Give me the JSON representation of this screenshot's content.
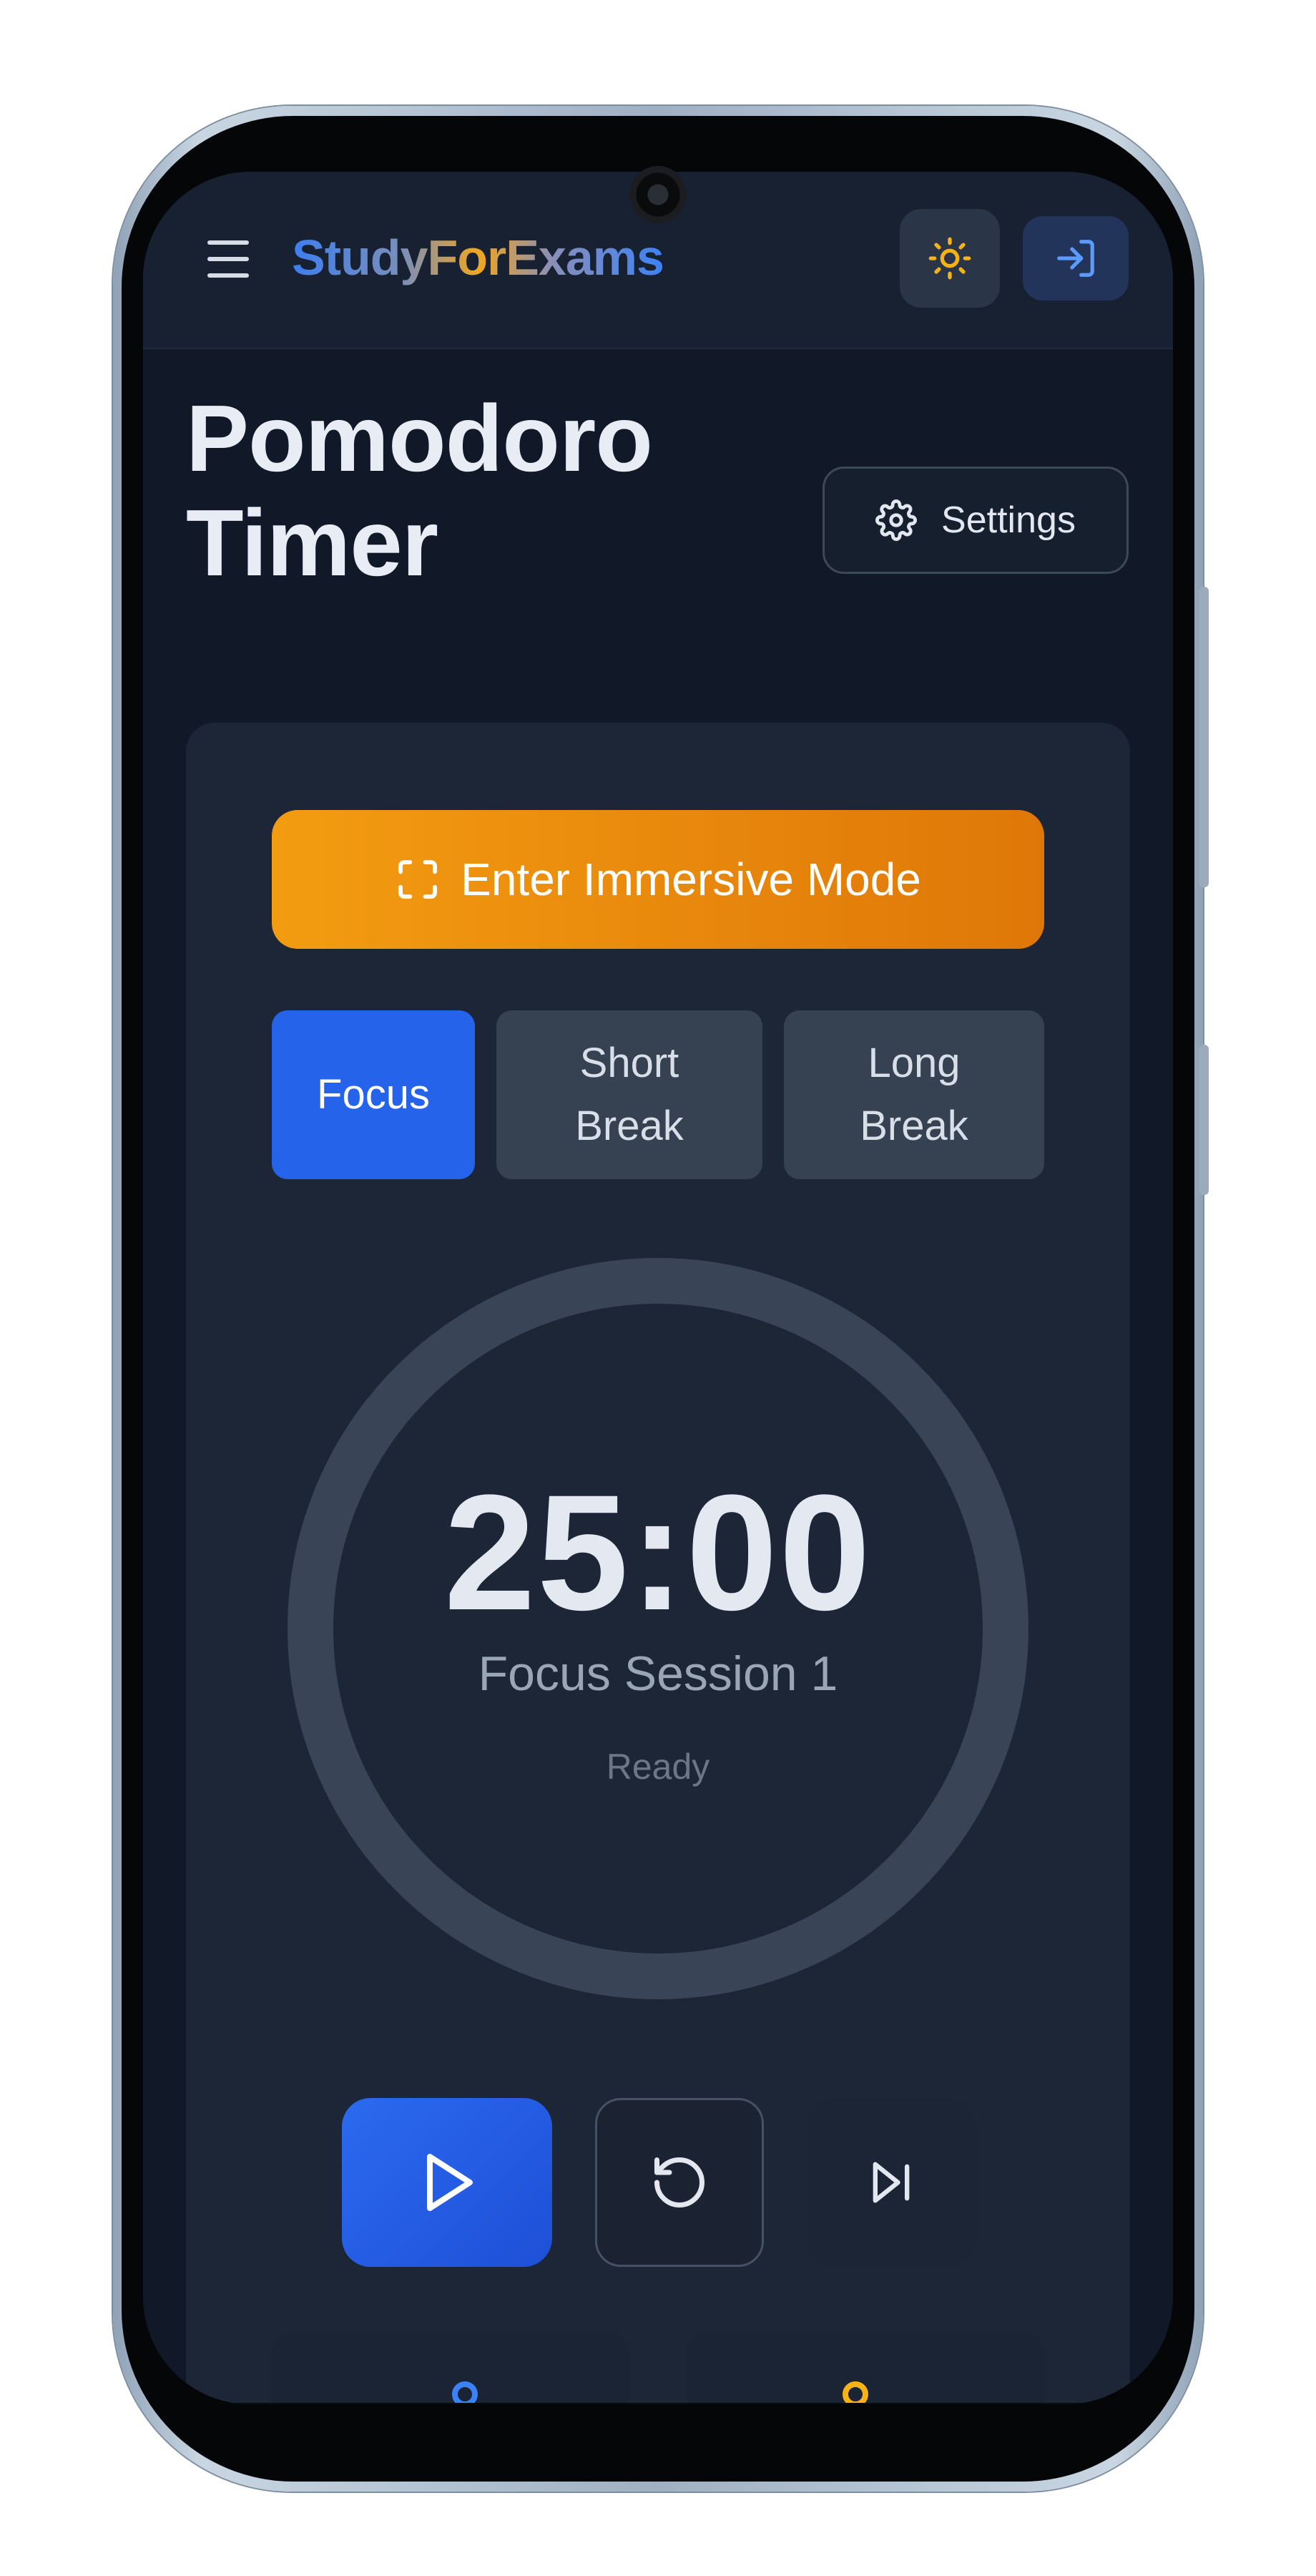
{
  "header": {
    "logo": "StudyForExams",
    "menu_icon": "hamburger-menu-icon",
    "theme_icon": "sun-icon",
    "login_icon": "log-in-icon"
  },
  "page": {
    "title": "Pomodoro Timer",
    "settings_label": "Settings",
    "settings_icon": "gear-icon"
  },
  "immersive": {
    "label": "Enter Immersive Mode",
    "icon": "fullscreen-icon"
  },
  "modes": [
    {
      "label": "Focus",
      "active": true
    },
    {
      "label": "Short Break",
      "active": false
    },
    {
      "label": "Long Break",
      "active": false
    }
  ],
  "timer": {
    "time": "25:00",
    "session": "Focus Session 1",
    "status": "Ready"
  },
  "controls": {
    "play_icon": "play-icon",
    "reset_icon": "reset-icon",
    "skip_icon": "skip-forward-icon"
  },
  "colors": {
    "background": "#111827",
    "card": "#1d2637",
    "accent_blue": "#2563eb",
    "accent_orange": "#f39c11",
    "sun_yellow": "#f5b316"
  }
}
